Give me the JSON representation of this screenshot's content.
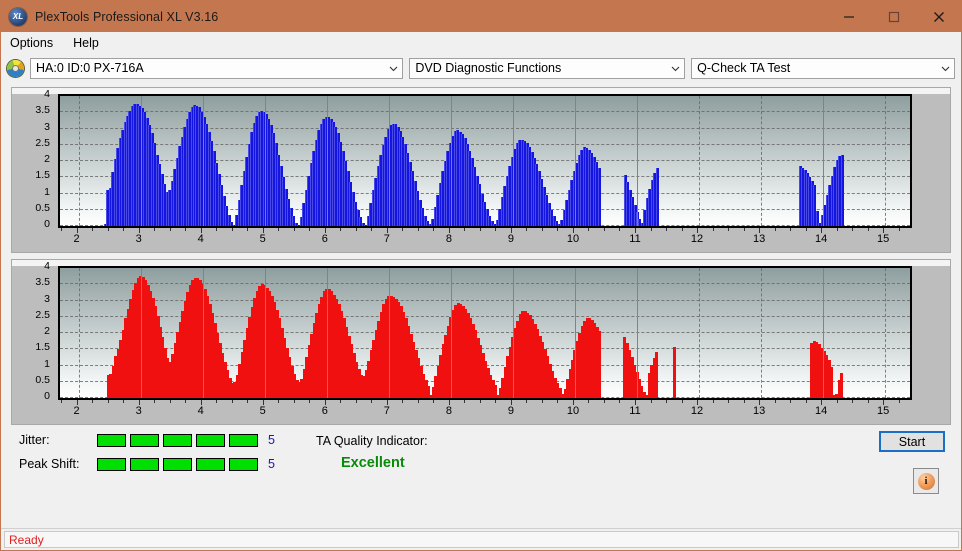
{
  "window": {
    "title": "PlexTools Professional XL V3.16",
    "app_icon": "xl-logo-icon",
    "minimize": "—",
    "maximize": "□",
    "close": "✕"
  },
  "menubar": {
    "items": [
      {
        "label": "Options"
      },
      {
        "label": "Help"
      }
    ]
  },
  "toolbar": {
    "drive_icon": "optical-disc-icon",
    "drive_select": {
      "value": "HA:0 ID:0  PX-716A"
    },
    "function_select": {
      "value": "DVD Diagnostic Functions"
    },
    "test_select": {
      "value": "Q-Check TA Test"
    }
  },
  "indicators": {
    "jitter_label": "Jitter:",
    "jitter_value": "5",
    "jitter_segments": 5,
    "peak_shift_label": "Peak Shift:",
    "peak_shift_value": "5",
    "peak_shift_segments": 5,
    "ta_quality_label": "TA Quality Indicator:",
    "ta_quality_value": "Excellent",
    "segment_color": "#00e000",
    "quality_color": "#0a8a0a"
  },
  "actions": {
    "start_label": "Start",
    "info_icon": "info-icon",
    "info_glyph": "i"
  },
  "statusbar": {
    "text": "Ready",
    "color": "#e02020"
  },
  "chart_data": [
    {
      "id": "jitter-chart",
      "type": "bar",
      "title": "",
      "xlabel": "",
      "ylabel": "",
      "series_color": "#1515e0",
      "marker_color": "#00e000",
      "grid": true,
      "xlim": [
        1.7,
        15.4
      ],
      "ylim": [
        0,
        4
      ],
      "yticks": [
        0,
        0.5,
        1,
        1.5,
        2,
        2.5,
        3,
        3.5,
        4
      ],
      "ytick_labels": [
        "0",
        "0.5",
        "1",
        "1.5",
        "2",
        "2.5",
        "3",
        "3.5",
        "4"
      ],
      "xticks": [
        2,
        3,
        4,
        5,
        6,
        7,
        8,
        9,
        10,
        11,
        12,
        13,
        14,
        15
      ],
      "xtick_labels": [
        "2",
        "3",
        "4",
        "5",
        "6",
        "7",
        "8",
        "9",
        "10",
        "11",
        "12",
        "13",
        "14",
        "15"
      ],
      "markers": [
        3,
        4,
        5,
        6,
        7,
        8,
        9,
        10,
        11,
        14
      ],
      "peaks": [
        {
          "x": 3,
          "value": 3.75
        },
        {
          "x": 4,
          "value": 3.72
        },
        {
          "x": 5,
          "value": 3.55
        },
        {
          "x": 6,
          "value": 3.35
        },
        {
          "x": 7,
          "value": 3.15
        },
        {
          "x": 8,
          "value": 2.95
        },
        {
          "x": 9,
          "value": 2.65
        },
        {
          "x": 10,
          "value": 2.42
        },
        {
          "x": 11,
          "value": 1.85
        },
        {
          "x": 14,
          "value": 2.2
        }
      ],
      "x": [
        2.42,
        2.46,
        2.5,
        2.54,
        2.58,
        2.62,
        2.66,
        2.7,
        2.74,
        2.78,
        2.82,
        2.86,
        2.9,
        2.94,
        2.98,
        3.02,
        3.06,
        3.1,
        3.14,
        3.18,
        3.22,
        3.26,
        3.3,
        3.34,
        3.38,
        3.42,
        3.46,
        3.5,
        3.54,
        3.58,
        3.62,
        3.66,
        3.7,
        3.74,
        3.78,
        3.82,
        3.86,
        3.9,
        3.94,
        3.98,
        4.02,
        4.06,
        4.1,
        4.14,
        4.18,
        4.22,
        4.26,
        4.3,
        4.34,
        4.38,
        4.42,
        4.46,
        4.5,
        4.54,
        4.58,
        4.62,
        4.66,
        4.7,
        4.74,
        4.78,
        4.82,
        4.86,
        4.9,
        4.94,
        4.98,
        5.02,
        5.06,
        5.1,
        5.14,
        5.18,
        5.22,
        5.26,
        5.3,
        5.34,
        5.38,
        5.42,
        5.46,
        5.5,
        5.54,
        5.58,
        5.62,
        5.66,
        5.7,
        5.74,
        5.78,
        5.82,
        5.86,
        5.9,
        5.94,
        5.98,
        6.02,
        6.06,
        6.1,
        6.14,
        6.18,
        6.22,
        6.26,
        6.3,
        6.34,
        6.38,
        6.42,
        6.46,
        6.5,
        6.54,
        6.58,
        6.62,
        6.66,
        6.7,
        6.74,
        6.78,
        6.82,
        6.86,
        6.9,
        6.94,
        6.98,
        7.02,
        7.06,
        7.1,
        7.14,
        7.18,
        7.22,
        7.26,
        7.3,
        7.34,
        7.38,
        7.42,
        7.46,
        7.5,
        7.54,
        7.58,
        7.62,
        7.66,
        7.7,
        7.74,
        7.78,
        7.82,
        7.86,
        7.9,
        7.94,
        7.98,
        8.02,
        8.06,
        8.1,
        8.14,
        8.18,
        8.22,
        8.26,
        8.3,
        8.34,
        8.38,
        8.42,
        8.46,
        8.5,
        8.54,
        8.58,
        8.62,
        8.66,
        8.7,
        8.74,
        8.78,
        8.82,
        8.86,
        8.9,
        8.94,
        8.98,
        9.02,
        9.06,
        9.1,
        9.14,
        9.18,
        9.22,
        9.26,
        9.3,
        9.34,
        9.38,
        9.42,
        9.46,
        9.5,
        9.54,
        9.58,
        9.62,
        9.66,
        9.7,
        9.74,
        9.78,
        9.82,
        9.86,
        9.9,
        9.94,
        9.98,
        10.02,
        10.06,
        10.1,
        10.14,
        10.18,
        10.22,
        10.26,
        10.3,
        10.34,
        10.38,
        10.8,
        10.84,
        10.88,
        10.92,
        10.96,
        11.0,
        11.04,
        11.08,
        11.12,
        11.16,
        11.2,
        11.24,
        11.28,
        11.32,
        13.62,
        13.66,
        13.7,
        13.74,
        13.78,
        13.82,
        13.86,
        13.9,
        13.94,
        13.98,
        14.02,
        14.06,
        14.1,
        14.14,
        14.18,
        14.22,
        14.26,
        14.3
      ],
      "y": [
        0.05,
        1.1,
        1.18,
        1.65,
        2.05,
        2.4,
        2.7,
        2.95,
        3.2,
        3.4,
        3.55,
        3.68,
        3.75,
        3.74,
        3.7,
        3.62,
        3.5,
        3.32,
        3.1,
        2.85,
        2.55,
        2.2,
        1.9,
        1.6,
        1.3,
        1.05,
        1.12,
        1.4,
        1.75,
        2.1,
        2.45,
        2.75,
        3.05,
        3.3,
        3.52,
        3.66,
        3.72,
        3.7,
        3.65,
        3.52,
        3.36,
        3.15,
        2.9,
        2.62,
        2.3,
        1.95,
        1.6,
        1.25,
        0.92,
        0.62,
        0.35,
        0.12,
        0.04,
        0.35,
        0.8,
        1.25,
        1.7,
        2.12,
        2.52,
        2.88,
        3.18,
        3.4,
        3.52,
        3.55,
        3.52,
        3.44,
        3.3,
        3.1,
        2.85,
        2.55,
        2.2,
        1.85,
        1.5,
        1.15,
        0.82,
        0.55,
        0.3,
        0.1,
        0.03,
        0.28,
        0.7,
        1.12,
        1.55,
        1.95,
        2.32,
        2.65,
        2.95,
        3.15,
        3.28,
        3.34,
        3.35,
        3.3,
        3.2,
        3.05,
        2.85,
        2.6,
        2.32,
        2.0,
        1.68,
        1.35,
        1.05,
        0.75,
        0.5,
        0.28,
        0.1,
        0.04,
        0.32,
        0.72,
        1.1,
        1.48,
        1.85,
        2.18,
        2.48,
        2.75,
        2.98,
        3.1,
        3.15,
        3.13,
        3.05,
        2.92,
        2.75,
        2.52,
        2.26,
        1.98,
        1.68,
        1.38,
        1.08,
        0.8,
        0.55,
        0.32,
        0.14,
        0.05,
        0.22,
        0.58,
        0.95,
        1.32,
        1.68,
        2.0,
        2.3,
        2.56,
        2.78,
        2.92,
        2.95,
        2.9,
        2.82,
        2.7,
        2.52,
        2.32,
        2.08,
        1.82,
        1.55,
        1.28,
        1.0,
        0.75,
        0.52,
        0.32,
        0.15,
        0.05,
        0.2,
        0.52,
        0.88,
        1.22,
        1.55,
        1.85,
        2.12,
        2.36,
        2.55,
        2.64,
        2.65,
        2.62,
        2.54,
        2.42,
        2.28,
        2.1,
        1.9,
        1.68,
        1.45,
        1.2,
        0.96,
        0.72,
        0.5,
        0.32,
        0.16,
        0.05,
        0.18,
        0.48,
        0.8,
        1.12,
        1.42,
        1.7,
        1.95,
        2.18,
        2.35,
        2.42,
        2.4,
        2.34,
        2.25,
        2.12,
        1.96,
        1.78,
        1.58,
        1.36,
        1.12,
        0.88,
        0.64,
        0.42,
        0.22,
        0.08,
        0.5,
        0.85,
        1.15,
        1.42,
        1.62,
        1.78,
        1.85,
        1.8,
        1.72,
        1.62,
        1.52,
        1.38,
        1.25,
        0.45,
        0.1,
        0.35,
        0.65,
        0.95,
        1.25,
        1.55,
        1.82,
        2.02,
        2.15,
        2.2,
        2.16,
        2.06,
        1.92,
        1.75,
        1.55,
        1.3,
        1.0,
        0.55
      ]
    },
    {
      "id": "peak-shift-chart",
      "type": "bar",
      "title": "",
      "xlabel": "",
      "ylabel": "",
      "series_color": "#f01010",
      "marker_color": "#00e000",
      "grid": true,
      "xlim": [
        1.7,
        15.4
      ],
      "ylim": [
        0,
        4
      ],
      "yticks": [
        0,
        0.5,
        1,
        1.5,
        2,
        2.5,
        3,
        3.5,
        4
      ],
      "ytick_labels": [
        "0",
        "0.5",
        "1",
        "1.5",
        "2",
        "2.5",
        "3",
        "3.5",
        "4"
      ],
      "xticks": [
        2,
        3,
        4,
        5,
        6,
        7,
        8,
        9,
        10,
        11,
        12,
        13,
        14,
        15
      ],
      "xtick_labels": [
        "2",
        "3",
        "4",
        "5",
        "6",
        "7",
        "8",
        "9",
        "10",
        "11",
        "12",
        "13",
        "14",
        "15"
      ],
      "markers": [
        3,
        4,
        5,
        6,
        7,
        8,
        9,
        10,
        11,
        14
      ],
      "peaks": [
        {
          "x": 3,
          "value": 3.75
        },
        {
          "x": 4,
          "value": 3.7
        },
        {
          "x": 5,
          "value": 3.5
        },
        {
          "x": 6,
          "value": 3.35
        },
        {
          "x": 7,
          "value": 3.15
        },
        {
          "x": 8,
          "value": 2.92
        },
        {
          "x": 9,
          "value": 2.68
        },
        {
          "x": 10,
          "value": 2.45
        },
        {
          "x": 11,
          "value": 1.75
        },
        {
          "x": 14,
          "value": 1.15
        }
      ],
      "x": [
        2.48,
        2.52,
        2.56,
        2.6,
        2.64,
        2.68,
        2.72,
        2.76,
        2.8,
        2.84,
        2.88,
        2.92,
        2.96,
        3.0,
        3.04,
        3.08,
        3.12,
        3.16,
        3.2,
        3.24,
        3.28,
        3.32,
        3.36,
        3.4,
        3.44,
        3.48,
        3.52,
        3.56,
        3.6,
        3.64,
        3.68,
        3.72,
        3.76,
        3.8,
        3.84,
        3.88,
        3.92,
        3.96,
        4.0,
        4.04,
        4.08,
        4.12,
        4.16,
        4.2,
        4.24,
        4.28,
        4.32,
        4.36,
        4.4,
        4.44,
        4.48,
        4.52,
        4.56,
        4.6,
        4.64,
        4.68,
        4.72,
        4.76,
        4.8,
        4.84,
        4.88,
        4.92,
        4.96,
        5.0,
        5.04,
        5.08,
        5.12,
        5.16,
        5.2,
        5.24,
        5.28,
        5.32,
        5.36,
        5.4,
        5.44,
        5.48,
        5.52,
        5.56,
        5.6,
        5.64,
        5.68,
        5.72,
        5.76,
        5.8,
        5.84,
        5.88,
        5.92,
        5.96,
        6.0,
        6.04,
        6.08,
        6.12,
        6.16,
        6.2,
        6.24,
        6.28,
        6.32,
        6.36,
        6.4,
        6.44,
        6.48,
        6.52,
        6.56,
        6.6,
        6.64,
        6.68,
        6.72,
        6.76,
        6.8,
        6.84,
        6.88,
        6.92,
        6.96,
        7.0,
        7.04,
        7.08,
        7.12,
        7.16,
        7.2,
        7.24,
        7.28,
        7.32,
        7.36,
        7.4,
        7.44,
        7.48,
        7.52,
        7.56,
        7.6,
        7.64,
        7.68,
        7.72,
        7.76,
        7.8,
        7.84,
        7.88,
        7.92,
        7.96,
        8.0,
        8.04,
        8.08,
        8.12,
        8.16,
        8.2,
        8.24,
        8.28,
        8.32,
        8.36,
        8.4,
        8.44,
        8.48,
        8.52,
        8.56,
        8.6,
        8.64,
        8.68,
        8.72,
        8.76,
        8.8,
        8.84,
        8.88,
        8.92,
        8.96,
        9.0,
        9.04,
        9.08,
        9.12,
        9.16,
        9.2,
        9.24,
        9.28,
        9.32,
        9.36,
        9.4,
        9.44,
        9.48,
        9.52,
        9.56,
        9.6,
        9.64,
        9.68,
        9.72,
        9.76,
        9.8,
        9.84,
        9.88,
        9.92,
        9.96,
        10.0,
        10.04,
        10.08,
        10.12,
        10.16,
        10.2,
        10.24,
        10.28,
        10.32,
        10.36,
        10.4,
        10.8,
        10.84,
        10.88,
        10.92,
        10.96,
        11.0,
        11.04,
        11.08,
        11.12,
        11.16,
        11.2,
        11.24,
        11.28,
        11.32,
        11.6,
        13.82,
        13.86,
        13.9,
        13.94,
        13.98,
        14.02,
        14.06,
        14.1,
        14.14,
        14.18,
        14.22,
        14.26,
        14.3
      ],
      "y": [
        0.7,
        0.75,
        0.98,
        1.3,
        1.52,
        1.8,
        2.1,
        2.45,
        2.75,
        3.05,
        3.32,
        3.55,
        3.7,
        3.75,
        3.72,
        3.62,
        3.48,
        3.3,
        3.08,
        2.82,
        2.52,
        2.2,
        1.88,
        1.55,
        1.22,
        1.1,
        1.35,
        1.68,
        2.02,
        2.35,
        2.68,
        2.98,
        3.25,
        3.48,
        3.62,
        3.7,
        3.68,
        3.62,
        3.52,
        3.36,
        3.15,
        2.9,
        2.62,
        2.32,
        2.0,
        1.68,
        1.38,
        1.1,
        0.85,
        0.62,
        0.45,
        0.48,
        0.72,
        1.05,
        1.42,
        1.8,
        2.15,
        2.48,
        2.8,
        3.08,
        3.3,
        3.45,
        3.5,
        3.48,
        3.4,
        3.3,
        3.15,
        2.95,
        2.72,
        2.45,
        2.15,
        1.85,
        1.55,
        1.25,
        0.98,
        0.75,
        0.55,
        0.48,
        0.6,
        0.9,
        1.25,
        1.62,
        1.98,
        2.32,
        2.62,
        2.9,
        3.12,
        3.28,
        3.35,
        3.34,
        3.28,
        3.18,
        3.05,
        2.88,
        2.68,
        2.45,
        2.2,
        1.92,
        1.65,
        1.38,
        1.12,
        0.9,
        0.72,
        0.68,
        0.85,
        1.15,
        1.48,
        1.8,
        2.1,
        2.38,
        2.65,
        2.88,
        3.05,
        3.14,
        3.15,
        3.12,
        3.05,
        2.95,
        2.82,
        2.65,
        2.45,
        2.22,
        1.98,
        1.72,
        1.48,
        1.22,
        0.98,
        0.75,
        0.55,
        0.38,
        0.1,
        0.35,
        0.68,
        1.0,
        1.32,
        1.65,
        1.95,
        2.22,
        2.48,
        2.7,
        2.86,
        2.92,
        2.9,
        2.84,
        2.74,
        2.62,
        2.46,
        2.28,
        2.08,
        1.85,
        1.62,
        1.38,
        1.15,
        0.92,
        0.72,
        0.55,
        0.4,
        0.08,
        0.3,
        0.62,
        0.95,
        1.28,
        1.58,
        1.88,
        2.15,
        2.38,
        2.58,
        2.68,
        2.68,
        2.62,
        2.54,
        2.42,
        2.28,
        2.12,
        1.92,
        1.72,
        1.5,
        1.28,
        1.05,
        0.82,
        0.62,
        0.45,
        0.3,
        0.12,
        0.28,
        0.58,
        0.88,
        1.18,
        1.48,
        1.75,
        2.0,
        2.22,
        2.38,
        2.45,
        2.45,
        2.4,
        2.32,
        2.2,
        2.05,
        1.88,
        1.68,
        1.48,
        1.25,
        1.02,
        0.8,
        0.58,
        0.38,
        0.2,
        0.08,
        0.78,
        1.02,
        1.22,
        1.42,
        1.58,
        1.7,
        1.75,
        1.72,
        1.65,
        1.55,
        1.45,
        1.32,
        1.18,
        0.95,
        0.1,
        0.12,
        0.55,
        0.78,
        0.92,
        1.08,
        1.15,
        1.12,
        1.1,
        1.02,
        0.88,
        0.62,
        0.28,
        0.1
      ]
    }
  ]
}
